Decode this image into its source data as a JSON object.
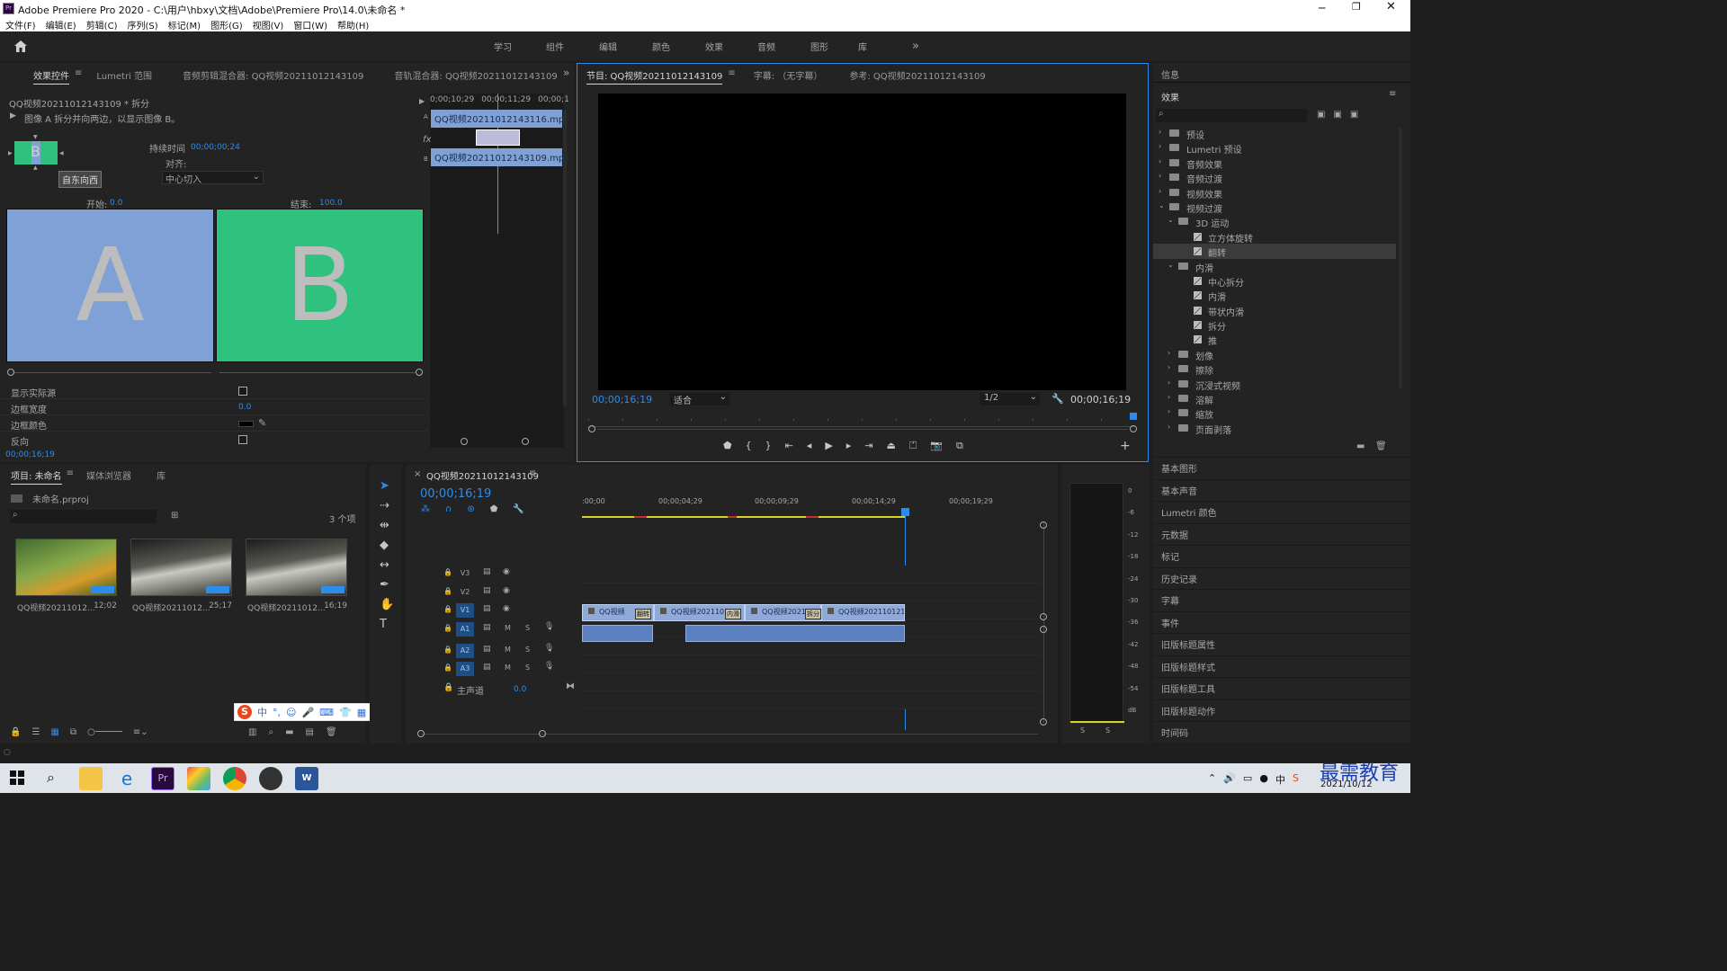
{
  "window": {
    "title": "Adobe Premiere Pro 2020 - C:\\用户\\hbxy\\文档\\Adobe\\Premiere Pro\\14.0\\未命名 *"
  },
  "menu": [
    "文件(F)",
    "编辑(E)",
    "剪辑(C)",
    "序列(S)",
    "标记(M)",
    "图形(G)",
    "视图(V)",
    "窗口(W)",
    "帮助(H)"
  ],
  "workspaces": [
    "学习",
    "组件",
    "编辑",
    "颜色",
    "效果",
    "音频",
    "图形",
    "库"
  ],
  "effect_controls": {
    "tabs": [
      "效果控件",
      "Lumetri 范围",
      "音频剪辑混合器: QQ视频20211012143109",
      "音轨混合器: QQ视频20211012143109"
    ],
    "clip_title": "QQ视频20211012143109 * 拆分",
    "description": "图像 A 拆分并向两边，以显示图像 B。",
    "direction_tooltip": "自东向西",
    "duration_label": "持续时间",
    "duration_value": "00;00;00;24",
    "align_label": "对齐:",
    "align_value": "中心切入",
    "start_label": "开始:",
    "start_value": "0.0",
    "end_label": "结束:",
    "end_value": "100.0",
    "preview_a": "A",
    "preview_b": "B",
    "props": [
      {
        "label": "显示实际源",
        "value": ""
      },
      {
        "label": "边框宽度",
        "value": "0.0"
      },
      {
        "label": "边框颜色",
        "value": ""
      },
      {
        "label": "反向",
        "value": ""
      }
    ],
    "timecode": "00;00;16;19",
    "mini_ruler": [
      "0;00;10;29",
      "00;00;11;29",
      "00;00;1"
    ],
    "mini_clip_a": "QQ视频20211012143116.mp4",
    "mini_clip_b": "QQ视频20211012143109.mp4",
    "fx_label": "fx",
    "track_a": "A",
    "track_b": "B"
  },
  "program": {
    "tabs": [
      "节目: QQ视频20211012143109",
      "字幕: （无字幕）",
      "参考: QQ视频20211012143109"
    ],
    "timecode_left": "00;00;16;19",
    "fit": "适合",
    "resolution": "1/2",
    "timecode_right": "00;00;16;19"
  },
  "effects_panel": {
    "info_tab": "信息",
    "title": "效果",
    "tree": [
      {
        "label": "预设",
        "level": 0,
        "kind": "folder",
        "open": false
      },
      {
        "label": "Lumetri 预设",
        "level": 0,
        "kind": "folder",
        "open": false
      },
      {
        "label": "音频效果",
        "level": 0,
        "kind": "folder",
        "open": false
      },
      {
        "label": "音频过渡",
        "level": 0,
        "kind": "folder",
        "open": false
      },
      {
        "label": "视频效果",
        "level": 0,
        "kind": "folder",
        "open": false
      },
      {
        "label": "视频过渡",
        "level": 0,
        "kind": "folder",
        "open": true
      },
      {
        "label": "3D 运动",
        "level": 1,
        "kind": "folder",
        "open": true
      },
      {
        "label": "立方体旋转",
        "level": 2,
        "kind": "fx",
        "open": false
      },
      {
        "label": "翻转",
        "level": 2,
        "kind": "fx",
        "open": false,
        "selected": true
      },
      {
        "label": "内滑",
        "level": 1,
        "kind": "folder",
        "open": true
      },
      {
        "label": "中心拆分",
        "level": 2,
        "kind": "fx",
        "open": false
      },
      {
        "label": "内滑",
        "level": 2,
        "kind": "fx",
        "open": false
      },
      {
        "label": "带状内滑",
        "level": 2,
        "kind": "fx",
        "open": false
      },
      {
        "label": "拆分",
        "level": 2,
        "kind": "fx",
        "open": false
      },
      {
        "label": "推",
        "level": 2,
        "kind": "fx",
        "open": false
      },
      {
        "label": "划像",
        "level": 1,
        "kind": "folder",
        "open": false
      },
      {
        "label": "擦除",
        "level": 1,
        "kind": "folder",
        "open": false
      },
      {
        "label": "沉浸式视频",
        "level": 1,
        "kind": "folder",
        "open": false
      },
      {
        "label": "溶解",
        "level": 1,
        "kind": "folder",
        "open": false
      },
      {
        "label": "缩放",
        "level": 1,
        "kind": "folder",
        "open": false
      },
      {
        "label": "页面剥落",
        "level": 1,
        "kind": "folder",
        "open": false
      }
    ],
    "collapsed": [
      "基本图形",
      "基本声音",
      "Lumetri 颜色",
      "元数据",
      "标记",
      "历史记录",
      "字幕",
      "事件",
      "旧版标题属性",
      "旧版标题样式",
      "旧版标题工具",
      "旧版标题动作",
      "时间码"
    ]
  },
  "project": {
    "tabs": [
      "项目: 未命名",
      "媒体浏览器",
      "库"
    ],
    "file": "未命名.prproj",
    "count": "3 个项",
    "items": [
      {
        "name": "QQ视频20211012...",
        "dur": "12;02"
      },
      {
        "name": "QQ视频20211012...",
        "dur": "25;17"
      },
      {
        "name": "QQ视频20211012...",
        "dur": "16;19"
      }
    ]
  },
  "timeline": {
    "title": "QQ视频20211012143109",
    "timecode": "00;00;16;19",
    "ruler": [
      ":00;00",
      "00;00;04;29",
      "00;00;09;29",
      "00;00;14;29",
      "00;00;19;29"
    ],
    "video_tracks": [
      "V3",
      "V2",
      "V1"
    ],
    "audio_tracks": [
      "A1",
      "A2",
      "A3"
    ],
    "master_label": "主声道",
    "master_value": "0.0",
    "v1_clips": [
      "QQ视频",
      "QQ视频202110",
      "QQ视频2021",
      "QQ视频202110121"
    ],
    "transitions": [
      "翻转",
      "内滑",
      "拆分"
    ],
    "track_btn_m": "M",
    "track_btn_s": "S"
  },
  "meter": {
    "scale": [
      "0",
      "-6",
      "-12",
      "-18",
      "-24",
      "-30",
      "-36",
      "-42",
      "-48",
      "-54",
      "dB"
    ],
    "solo": [
      "S",
      "S"
    ]
  },
  "ime": {
    "label": "中"
  },
  "taskbar": {
    "date": "2021/10/12",
    "watermark": "最需教育"
  },
  "colors": {
    "accent": "#2d8ceb",
    "panel": "#232323",
    "clip": "#8fa9d9",
    "audio": "#5b7fbf",
    "green": "#2ec27e",
    "a_blue": "#7fa1d6"
  }
}
